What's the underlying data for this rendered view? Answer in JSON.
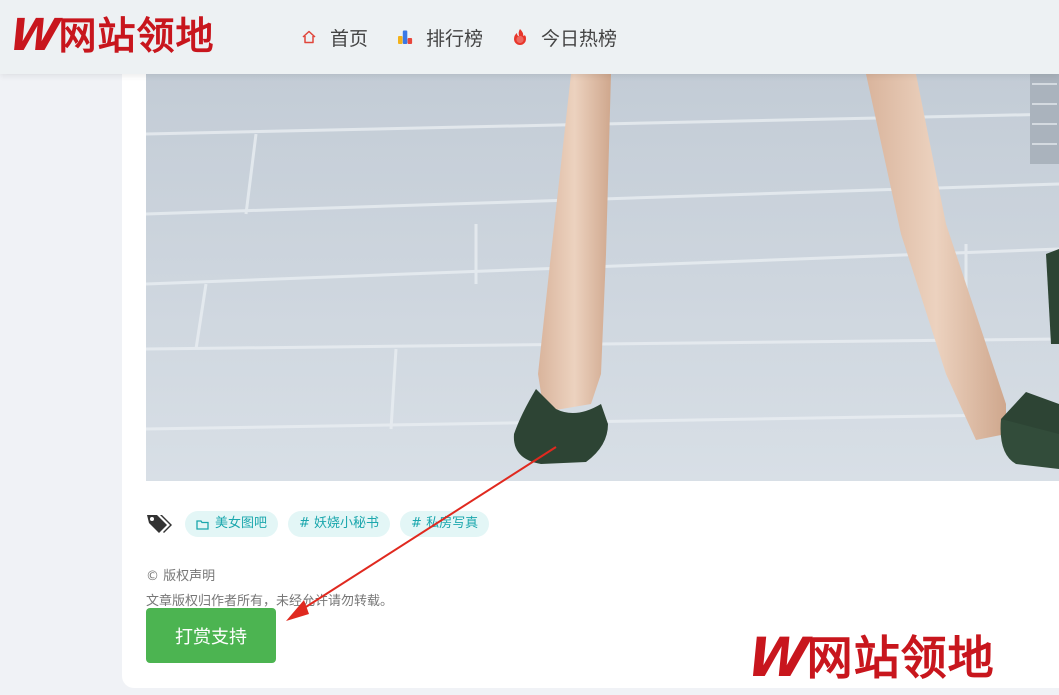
{
  "site": {
    "logo_mark": "W",
    "logo_text": "网站领地"
  },
  "nav": [
    {
      "label": "首页",
      "icon": "home-icon"
    },
    {
      "label": "排行榜",
      "icon": "ranking-icon"
    },
    {
      "label": "今日热榜",
      "icon": "hot-icon"
    }
  ],
  "tags": [
    {
      "label": "美女图吧",
      "icon": "folder-icon"
    },
    {
      "label": "# 妖娆小秘书"
    },
    {
      "label": "# 私房写真"
    }
  ],
  "copyright": {
    "title": "© 版权声明",
    "text": "文章版权归作者所有，未经允许请勿转载。"
  },
  "reward_button": "打赏支持",
  "watermark": {
    "mark": "W",
    "text": "网站领地"
  },
  "colors": {
    "brand": "#c8161d",
    "tag": "#1ba7ad",
    "button": "#4cb451",
    "arrow": "#e0291f"
  }
}
